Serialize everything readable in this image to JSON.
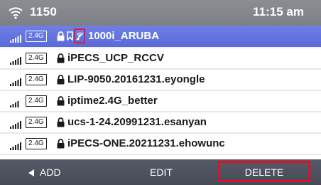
{
  "status_bar": {
    "icon": "wifi-icon",
    "extension": "1150",
    "time": "11:15 am"
  },
  "networks": [
    {
      "band": "2.4G",
      "ssid": "1000i_ARUBA",
      "selected": true,
      "secured": true,
      "saved": true,
      "connected": true
    },
    {
      "band": "2.4G",
      "ssid": "iPECS_UCP_RCCV",
      "selected": false,
      "secured": true
    },
    {
      "band": "2.4G",
      "ssid": "LIP-9050.20161231.eyongle",
      "selected": false,
      "secured": true
    },
    {
      "band": "2.4G",
      "ssid": "iptime2.4G_better",
      "selected": false,
      "secured": true
    },
    {
      "band": "2.4G",
      "ssid": "ucs-1-24.20991231.esanyan",
      "selected": false,
      "secured": true
    },
    {
      "band": "2.4G",
      "ssid": "iPECS-ONE.20211231.ehowunc",
      "selected": false,
      "secured": true
    }
  ],
  "softkeys": {
    "add": "ADD",
    "edit": "EDIT",
    "delete": "DELETE"
  },
  "colors": {
    "selected_row": "#6170de",
    "status_bar": "#848790",
    "bottom_bar": "#4e525e",
    "highlight": "#e0102a"
  }
}
